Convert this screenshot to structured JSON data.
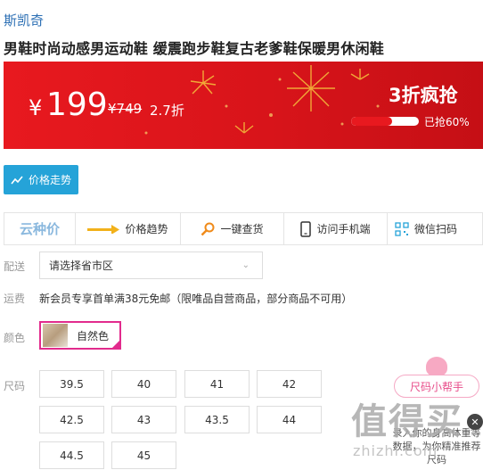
{
  "brand": "斯凯奇",
  "product_title": "男鞋时尚动感男运动鞋 缓震跑步鞋复古老爹鞋保暖男休闲鞋",
  "banner": {
    "currency": "¥",
    "price": "199",
    "original_price": "¥749",
    "discount": "2.7折",
    "flash_label": "3折疯抢",
    "sold_percent": 60,
    "sold_text": "已抢60%",
    "accent_color": "#e8191f"
  },
  "price_trend_button": "价格走势",
  "toolbar": {
    "logo": "云种价",
    "items": [
      {
        "label": "价格趋势",
        "icon": "arrow-right-icon"
      },
      {
        "label": "一键查货",
        "icon": "magnifier-icon"
      },
      {
        "label": "访问手机端",
        "icon": "phone-icon"
      },
      {
        "label": "微信扫码",
        "icon": "qrcode-icon"
      }
    ]
  },
  "delivery": {
    "label": "配送",
    "select_value": "请选择省市区"
  },
  "shipping": {
    "label": "运费",
    "text": "新会员专享首单满38元免邮（限唯品自营商品，部分商品不可用）"
  },
  "color": {
    "label": "颜色",
    "selected": "自然色"
  },
  "size": {
    "label": "尺码",
    "options": [
      "39.5",
      "40",
      "41",
      "42",
      "42.5",
      "43",
      "43.5",
      "44",
      "44.5",
      "45"
    ]
  },
  "helper": {
    "bubble": "尺码小帮手",
    "message": "录入你的身高体重等数据，为你精准推荐尺码"
  },
  "watermark": {
    "big": "值得买",
    "small": "zhizhi.com"
  }
}
